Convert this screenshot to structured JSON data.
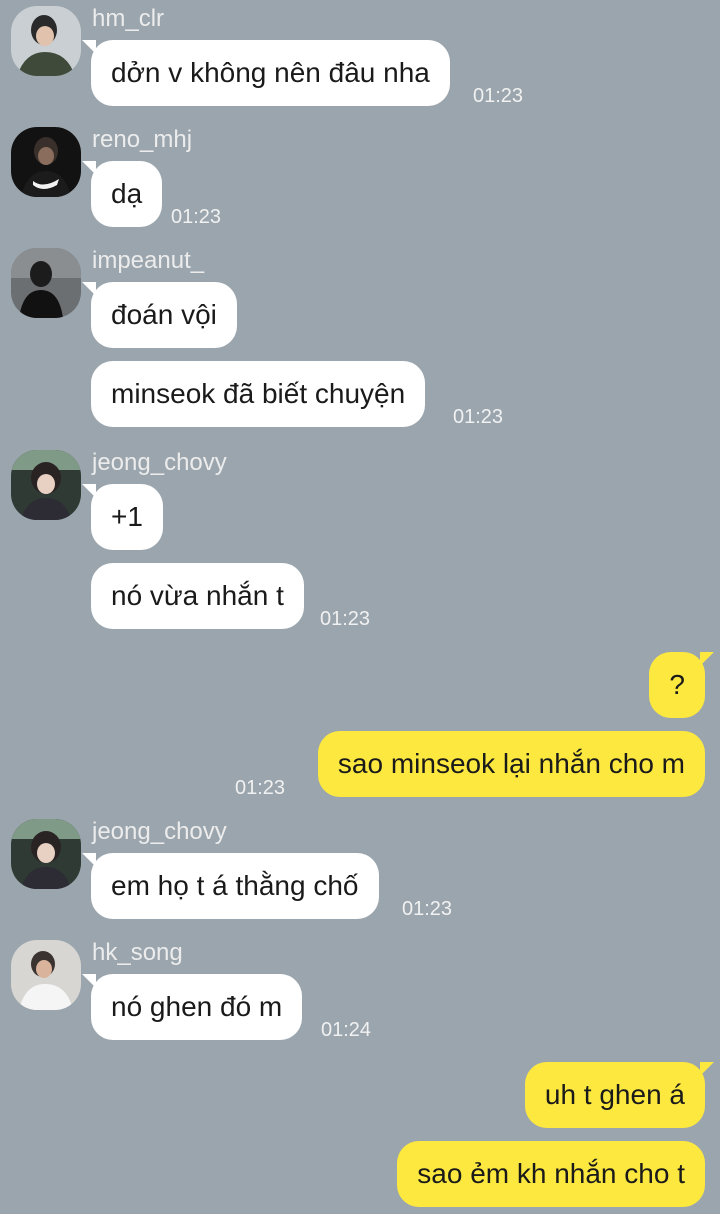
{
  "messages": [
    {
      "user": "hm_clr",
      "bubbles": [
        "dởn v không nên đâu nha"
      ],
      "time": "01:23"
    },
    {
      "user": "reno_mhj",
      "bubbles": [
        "dạ"
      ],
      "time": "01:23"
    },
    {
      "user": "impeanut_",
      "bubbles": [
        "đoán vội",
        "minseok đã biết chuyện"
      ],
      "time": "01:23"
    },
    {
      "user": "jeong_chovy",
      "bubbles": [
        "+1",
        "nó vừa nhắn t"
      ],
      "time": "01:23"
    },
    {
      "user": "me",
      "bubbles": [
        "?",
        "sao minseok lại nhắn cho m"
      ],
      "time": "01:23"
    },
    {
      "user": "jeong_chovy",
      "bubbles": [
        "em họ t á thằng chố"
      ],
      "time": "01:23"
    },
    {
      "user": "hk_song",
      "bubbles": [
        "nó ghen đó m"
      ],
      "time": "01:24"
    },
    {
      "user": "me",
      "bubbles": [
        "uh t ghen á",
        "sao ẻm kh nhắn cho t"
      ]
    }
  ],
  "colors": {
    "background": "#9aa5ad",
    "incoming_bubble": "#ffffff",
    "outgoing_bubble": "#fde83f"
  },
  "icons": {
    "avatar": "user-avatar-photo"
  }
}
